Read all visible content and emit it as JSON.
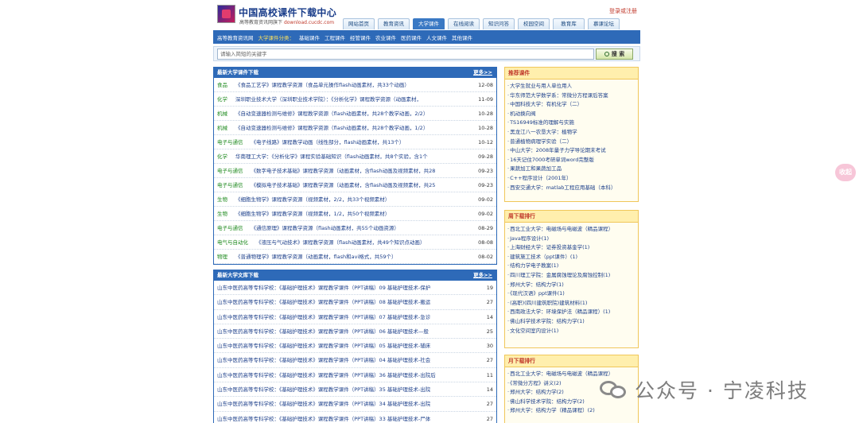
{
  "header": {
    "title": "中国高校课件下载中心",
    "subtitle": "高等教育资讯网旗下",
    "subtitle_domain": "download.cucdc.com",
    "login": "登录或注册"
  },
  "tabs": [
    "网站首页",
    "教育资讯",
    "大学课件",
    "在线阅读",
    "知识问答",
    "校园空间",
    "教育库",
    "慕课论坛"
  ],
  "navbar": {
    "home": "高等教育资讯网",
    "category_label": "大学课件分类：",
    "items": [
      "基础课件",
      "工程课件",
      "经管课件",
      "农业课件",
      "医药课件",
      "人文课件",
      "其他课件"
    ]
  },
  "search": {
    "placeholder": "请输入简短的关键字",
    "button": "搜 索"
  },
  "latest_courses": {
    "title": "最新大学课件下载",
    "more": "更多>>",
    "rows": [
      {
        "cat": "食品",
        "text": "《食品工艺学》课程教学资源（食品单元操作flash动画素材，共33个动画）",
        "date": "12-08"
      },
      {
        "cat": "化学",
        "text": "深圳职业技术大学（深圳职业技术学院）：《分析化学》课程教学资源（动画素材，",
        "date": "11-09"
      },
      {
        "cat": "机械",
        "text": "《自动变速器检测与维修》课程教学资源（flash动画素材，共28个教学动画，2/2）",
        "date": "10-28"
      },
      {
        "cat": "机械",
        "text": "《自动变速器检测与维修》课程教学资源（flash动画素材，共28个教学动画，1/2）",
        "date": "10-28"
      },
      {
        "cat": "电子与通信",
        "text": "《电子线路》课程教学动画（线性部分，flash动画素材，共13个）",
        "date": "10-12"
      },
      {
        "cat": "化学",
        "text": "华南理工大学：《分析化学》课程实验基础知识（flash动画素材，共8个实验，含1个",
        "date": "09-28"
      },
      {
        "cat": "电子与通信",
        "text": "《数字电子技术基础》课程教学资源（动画素材，含flash动画及视频素材，共28",
        "date": "09-23"
      },
      {
        "cat": "电子与通信",
        "text": "《模拟电子技术基础》课程教学资源（动画素材，含flash动画及视频素材，共25",
        "date": "09-23"
      },
      {
        "cat": "生物",
        "text": "《细胞生物学》课程教学资源（视频素材，2/2，共33个视频素材）",
        "date": "09-02"
      },
      {
        "cat": "生物",
        "text": "《细胞生物学》课程教学资源（视频素材，1/2，共50个视频素材）",
        "date": "09-02"
      },
      {
        "cat": "电子与通信",
        "text": "《通信原理》课程教学资源（flash动画素材，共55个动画资源）",
        "date": "08-29"
      },
      {
        "cat": "电气与自动化",
        "text": "《液压与气动技术》课程教学资源（flash动画素材，共49个知识点动画）",
        "date": "08-08"
      },
      {
        "cat": "物理",
        "text": "《普通物理学》课程教学资源（动画素材，flash和avi格式，共59个）",
        "date": "08-02"
      }
    ]
  },
  "latest_library": {
    "title": "最新大学文库下载",
    "more": "更多>>",
    "rows": [
      {
        "text": "山东中医药高等专科学校：《基础护理技术》课程教学课件（PPT讲稿）09 基础护理技术-保护",
        "count": "19"
      },
      {
        "text": "山东中医药高等专科学校：《基础护理技术》课程教学课件（PPT讲稿）08 基础护理技术-搬运",
        "count": "27"
      },
      {
        "text": "山东中医药高等专科学校：《基础护理技术》课程教学课件（PPT讲稿）07 基础护理技术-急诊",
        "count": "14"
      },
      {
        "text": "山东中医药高等专科学校：《基础护理技术》课程教学课件（PPT讲稿）06 基础护理技术—般",
        "count": "25"
      },
      {
        "text": "山东中医药高等专科学校：《基础护理技术》课程教学课件（PPT讲稿）05 基础护理技术-辅床",
        "count": "30"
      },
      {
        "text": "山东中医药高等专科学校：《基础护理技术》课程教学课件（PPT讲稿）04 基础护理技术-社会",
        "count": "27"
      },
      {
        "text": "山东中医药高等专科学校：《基础护理技术》课程教学课件（PPT讲稿）36 基础护理技术-出院后",
        "count": "11"
      },
      {
        "text": "山东中医药高等专科学校：《基础护理技术》课程教学课件（PPT讲稿）35 基础护理技术-出院",
        "count": "14"
      },
      {
        "text": "山东中医药高等专科学校：《基础护理技术》课程教学课件（PPT讲稿）34 基础护理技术-出院",
        "count": "27"
      },
      {
        "text": "山东中医药高等专科学校：《基础护理技术》课程教学课件（PPT讲稿）33 基础护理技术-尸体",
        "count": "27"
      }
    ]
  },
  "recommended": {
    "title": "推荐课件",
    "items": [
      "大学生就业与用人单位用人",
      "华东师范大学数学系：常微分方程课后答案",
      "中国科技大学：有机化学（二）",
      "机动换向阀",
      "TS16949标准的理解与实施",
      "黑龙江八一农垦大学：植物学",
      "普通植物病理学实验（二）",
      "中山大学：2008年量子力学导论期末考试",
      "16天记住7000考研单词word完整版",
      "果蔬加工和果蔬加工品",
      "C++程序设计（2001年）",
      "西安交通大学：matlab工程应用基础（本科）"
    ]
  },
  "weekly_rank": {
    "title": "周下载排行",
    "items": [
      "西北工业大学：电磁场与电磁波（精品课程）",
      "Java程序设计(1)",
      "上海财经大学：证券投资基金学(1)",
      "建筑施工技术（ppt课件）(1)",
      "结构力学电子教案(1)",
      "四川理工学院：金属腐蚀理论及腐蚀控制(1)",
      "郑州大学：结构力学(1)",
      "《现代汉语》ppt课件(1)",
      "(高职)(四川建筑职院)建筑材料(1)",
      "西南政法大学：环境保护法（精品课程）(1)",
      "佛山科学技术学院：结构力学(1)",
      "文化空间室内设计(1)"
    ]
  },
  "monthly_rank": {
    "title": "月下载排行",
    "items": [
      "西北工业大学：电磁场与电磁波（精品课程）",
      "《常微分方程》讲义(2)",
      "郑州大学：结构力学(2)",
      "佛山科学技术学院：结构力学(2)",
      "郑州大学：结构力学（精品课程）(2)"
    ]
  },
  "float_button": "收起",
  "watermark": "公众号 · 宁凌科技"
}
